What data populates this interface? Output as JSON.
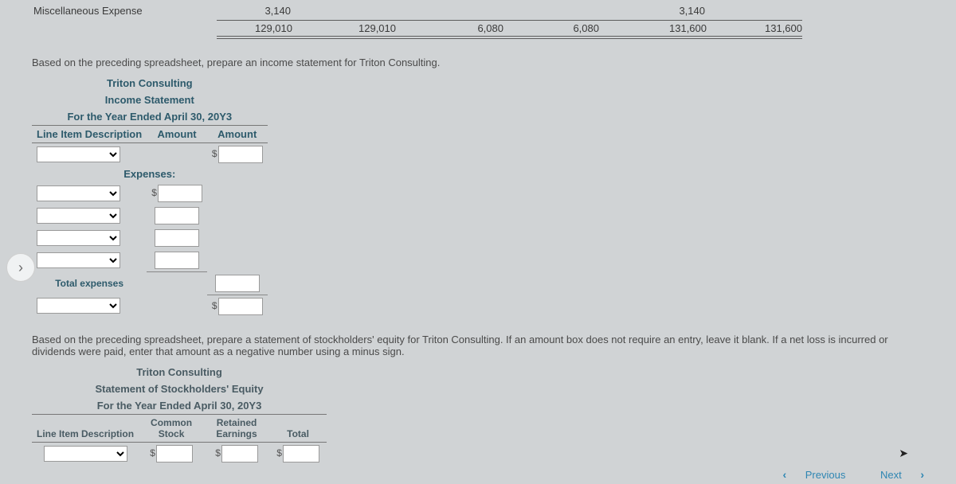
{
  "sheet": {
    "misc_label": "Miscellaneous Expense",
    "misc_adj_debit": "3,140",
    "misc_adj_bal_debit": "3,140",
    "totals": [
      "129,010",
      "129,010",
      "6,080",
      "6,080",
      "131,600",
      "131,600"
    ]
  },
  "instr1": "Based on the preceding spreadsheet, prepare an income statement for Triton Consulting.",
  "income": {
    "company": "Triton Consulting",
    "title": "Income Statement",
    "period": "For the Year Ended April 30, 20Y3",
    "col1": "Line Item Description",
    "col2": "Amount",
    "col3": "Amount",
    "expenses": "Expenses:",
    "total_expenses": "Total expenses"
  },
  "instr2": "Based on the preceding spreadsheet, prepare a statement of stockholders' equity for Triton Consulting. If an amount box does not require an entry, leave it blank. If a net loss is incurred or dividends were paid, enter that amount as a negative number using a minus sign.",
  "equity": {
    "company": "Triton Consulting",
    "title": "Statement of Stockholders' Equity",
    "period": "For the Year Ended April 30, 20Y3",
    "col_line": "Line Item Description",
    "col_cs": "Common Stock",
    "col_re": "Retained Earnings",
    "col_total": "Total"
  },
  "nav": {
    "prev": "Previous",
    "next": "Next"
  }
}
